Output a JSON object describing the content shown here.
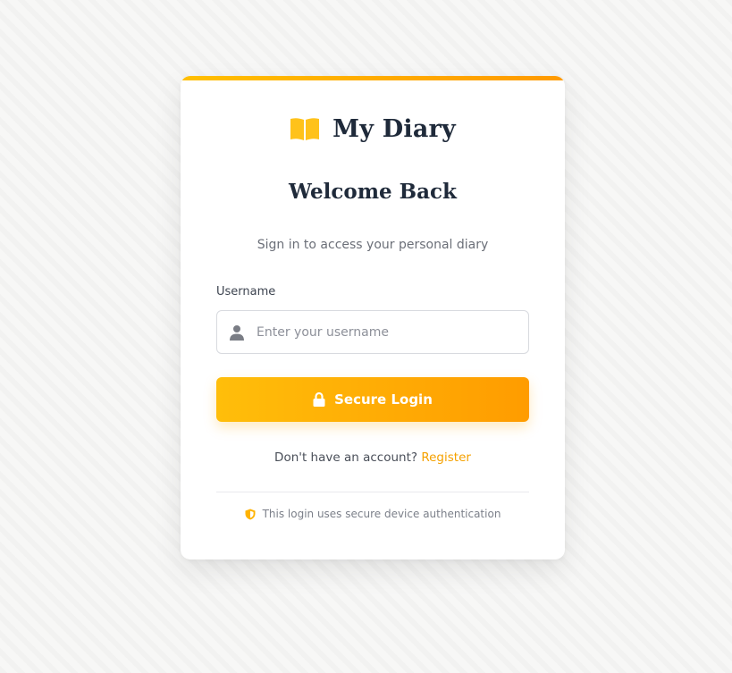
{
  "brand": {
    "name": "My Diary",
    "icon": "book-open-icon",
    "accent_color": "#ffb300"
  },
  "login": {
    "heading": "Welcome Back",
    "subtitle": "Sign in to access your personal diary",
    "username_label": "Username",
    "username_placeholder": "Enter your username",
    "username_value": "",
    "submit_label": "Secure Login",
    "register_prompt": "Don't have an account?",
    "register_link": "Register",
    "security_note": "This login uses secure device authentication"
  }
}
